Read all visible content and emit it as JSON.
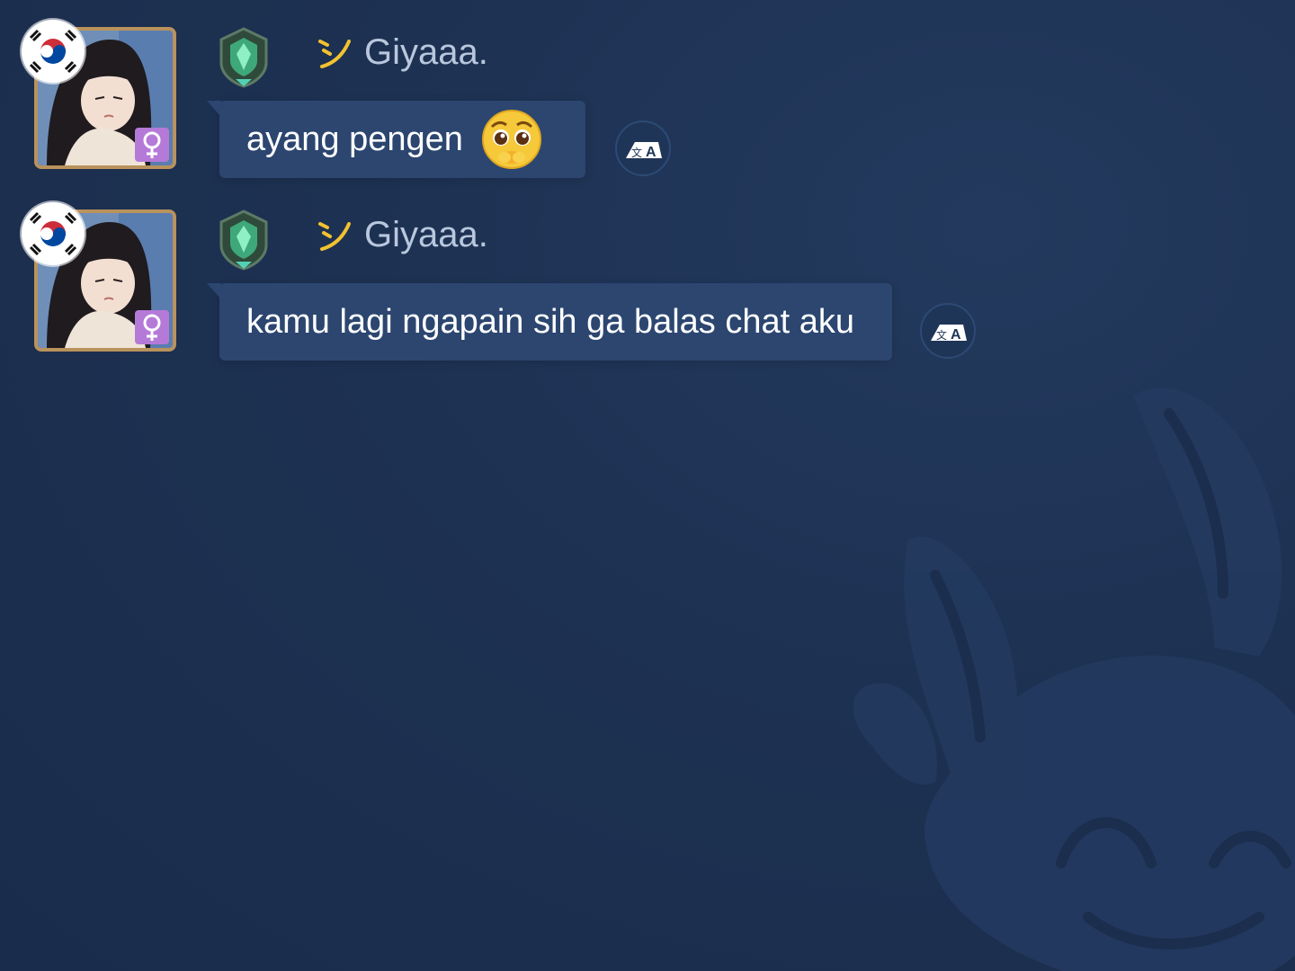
{
  "messages": [
    {
      "username": "Giyaaa.",
      "text": "ayang pengen",
      "has_emoji": true,
      "emoji_icon": "pleading-face-emoji",
      "flag_icon": "south-korea-flag-icon",
      "gender_icon": "female-icon",
      "rank_icon": "rank-badge-icon",
      "translate_icon": "translate-icon"
    },
    {
      "username": "Giyaaa.",
      "text": "kamu lagi ngapain sih ga balas chat aku",
      "has_emoji": false,
      "flag_icon": "south-korea-flag-icon",
      "gender_icon": "female-icon",
      "rank_icon": "rank-badge-icon",
      "translate_icon": "translate-icon"
    }
  ],
  "colors": {
    "background": "#1b2d4d",
    "bubble": "#2c4670",
    "username": "#b8c7dd",
    "frame": "#b9925c",
    "gender_badge": "#b57ad8",
    "tag_accent": "#f2c230"
  }
}
